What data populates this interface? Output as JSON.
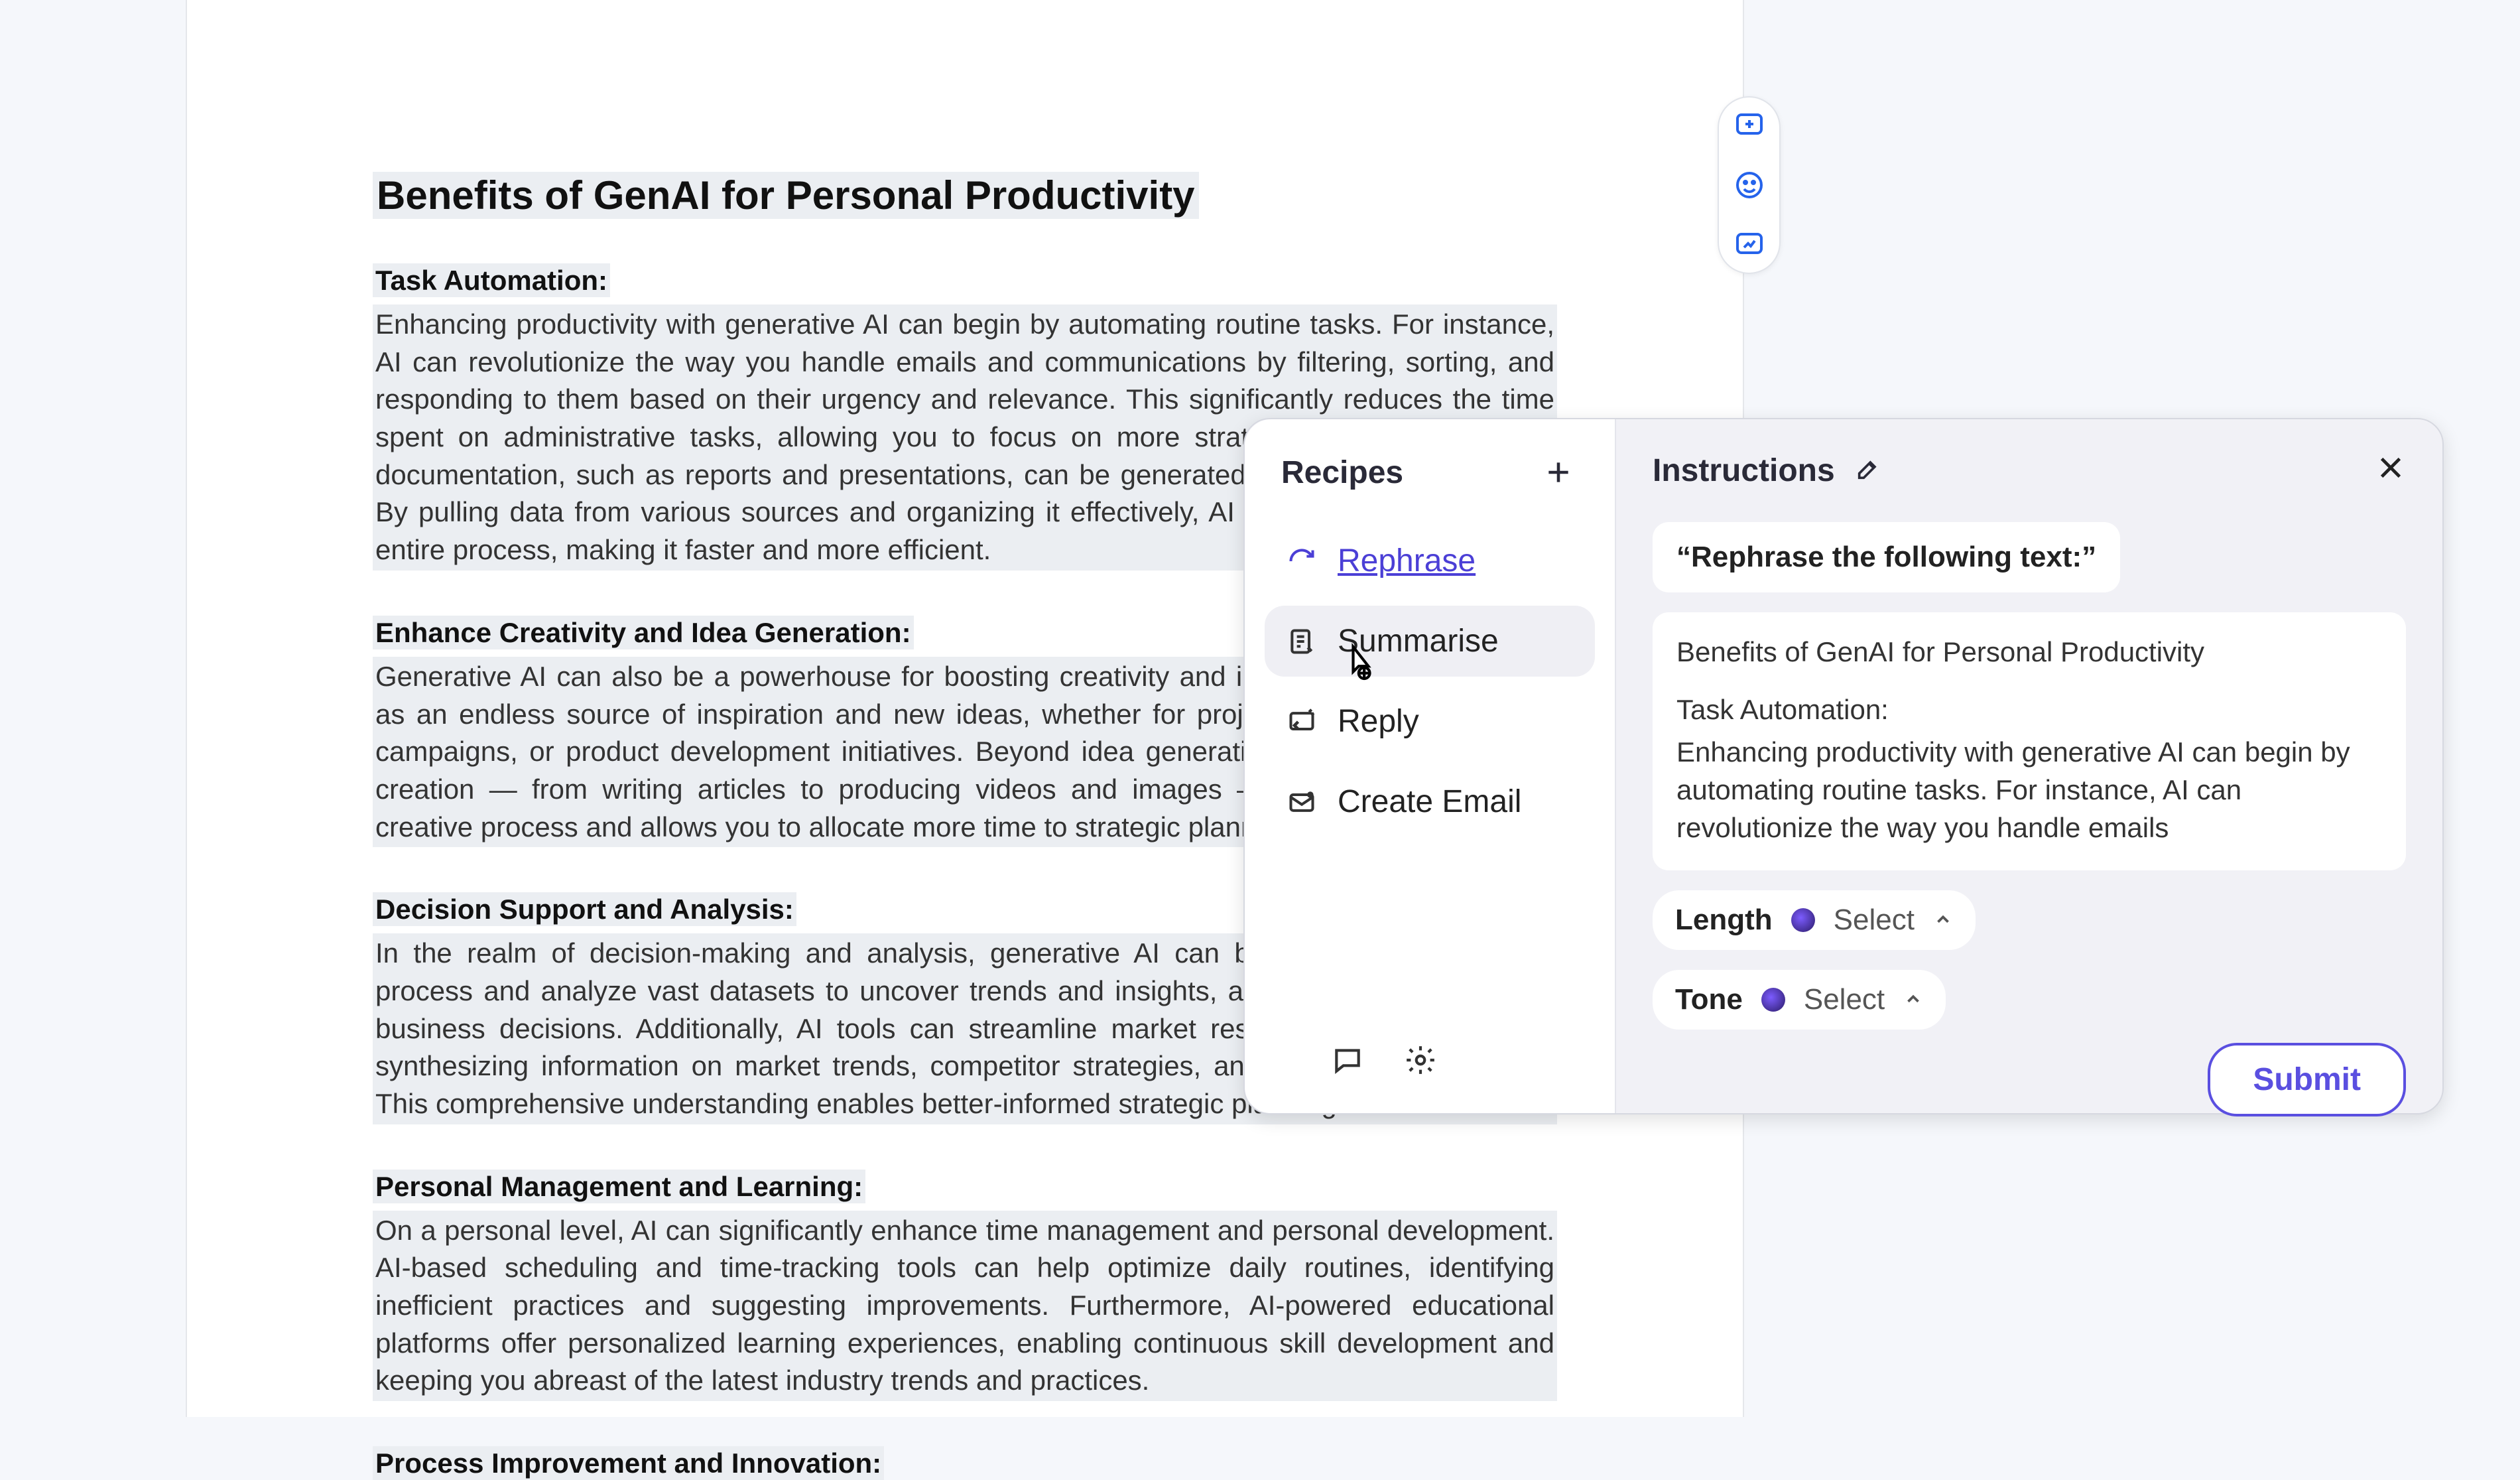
{
  "document": {
    "title": "Benefits of GenAI for Personal Productivity",
    "sections": [
      {
        "heading": "Task Automation:",
        "body": "Enhancing productivity with generative AI can begin by automating routine tasks. For instance, AI can revolutionize the way you handle emails and communications by filtering, sorting, and responding to them based on their urgency and relevance. This significantly reduces the time spent on administrative tasks, allowing you to focus on more strategic activities. Similarly, documentation, such as reports and presentations, can be generated efficiently by AI models. By pulling data from various sources and organizing it effectively, AI helps in streamlining the entire process, making it faster and more efficient."
      },
      {
        "heading": "Enhance Creativity and Idea Generation:",
        "body": "Generative AI can also be a powerhouse for boosting creativity and idea generation. Using AI as an endless source of inspiration and new ideas, whether for project proposals, marketing campaigns, or product development initiatives. Beyond idea generation, AI assists in content creation — from writing articles to producing videos and images — which speeds up the creative process and allows you to allocate more time to strategic planning."
      },
      {
        "heading": "Decision Support and Analysis:",
        "body": "In the realm of decision-making and analysis, generative AI can be transformative. It can process and analyze vast datasets to uncover trends and insights, aiding in making informed business decisions. Additionally, AI tools can streamline market research by compiling and synthesizing information on market trends, competitor strategies, and customer preferences. This comprehensive understanding enables better-informed strategic planning."
      },
      {
        "heading": "Personal Management and Learning:",
        "body": "On a personal level, AI can significantly enhance time management and personal development. AI-based scheduling and time-tracking tools can help optimize daily routines, identifying inefficient practices and suggesting improvements. Furthermore, AI-powered educational platforms offer personalized learning experiences, enabling continuous skill development and keeping you abreast of the latest industry trends and practices."
      },
      {
        "heading": "Process Improvement and Innovation:",
        "body": ""
      }
    ]
  },
  "floating_toolbar": {
    "icons": [
      "add-comment-icon",
      "emoji-icon",
      "suggest-icon"
    ]
  },
  "popover": {
    "recipes": {
      "title": "Recipes",
      "items": [
        {
          "label": "Rephrase",
          "icon": "refresh-icon",
          "active": true
        },
        {
          "label": "Summarise",
          "icon": "summary-icon",
          "hover": true
        },
        {
          "label": "Reply",
          "icon": "reply-icon"
        },
        {
          "label": "Create Email",
          "icon": "create-email-icon"
        }
      ],
      "footer_icons": [
        "chat-icon",
        "settings-icon"
      ]
    },
    "instructions": {
      "title": "Instructions",
      "prompt": "“Rephrase the following text:”",
      "context_title": "Benefits of GenAI for Personal Productivity",
      "context_subheading": "Task Automation:",
      "context_body": "Enhancing productivity with generative AI can begin by automating routine tasks. For instance, AI can revolutionize the way you handle emails",
      "length": {
        "label": "Length",
        "value": "Select"
      },
      "tone": {
        "label": "Tone",
        "value": "Select"
      },
      "submit": "Submit"
    }
  }
}
